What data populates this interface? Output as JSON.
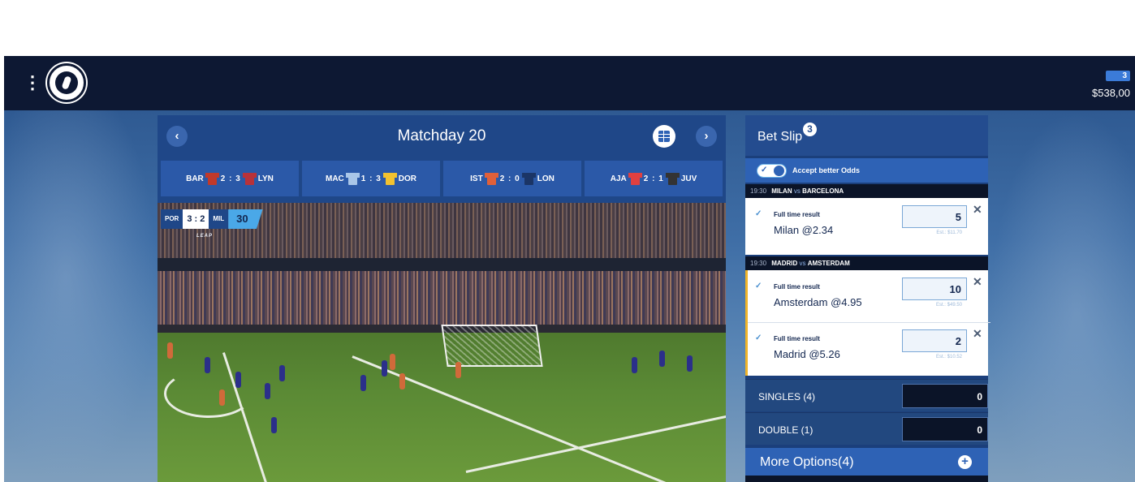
{
  "topbar": {
    "menu_icon": "more-vertical-icon",
    "logo_icon": "league-logo-icon",
    "wallet_badge": "3",
    "balance": "$538,00"
  },
  "matchday": {
    "title": "Matchday 20",
    "prev_icon": "chevron-left-icon",
    "next_icon": "chevron-right-icon",
    "table_icon": "table-icon",
    "results": [
      {
        "home": "BAR",
        "score": "2 : 3",
        "away": "LYN",
        "home_color": "#c0392b",
        "away_color": "#b8323a"
      },
      {
        "home": "MAC",
        "score": "1 : 3",
        "away": "DOR",
        "home_color": "#a9c6e8",
        "away_color": "#f2c230"
      },
      {
        "home": "IST",
        "score": "2 : 0",
        "away": "LON",
        "home_color": "#e0603a",
        "away_color": "#1b3566"
      },
      {
        "home": "AJA",
        "score": "2 : 1",
        "away": "JUV",
        "home_color": "#e04040",
        "away_color": "#333333"
      }
    ]
  },
  "live": {
    "home": "POR",
    "score": "3 : 2",
    "away": "MIL",
    "minute": "30",
    "tag": "LEAP"
  },
  "betslip": {
    "title": "Bet Slip",
    "count": "3",
    "accept_label": "Accept better Odds",
    "matches": [
      {
        "time": "19:30",
        "home": "MILAN",
        "vs": "vs",
        "away": "BARCELONA",
        "bets": [
          {
            "market": "Full time result",
            "selection": "Milan @2.34",
            "stake": "5",
            "est": "Est.: $11.70"
          }
        ]
      },
      {
        "time": "19:30",
        "home": "MADRID",
        "vs": "vs",
        "away": "AMSTERDAM",
        "bets": [
          {
            "market": "Full time result",
            "selection": "Amsterdam @4.95",
            "stake": "10",
            "est": "Est.: $49.50"
          },
          {
            "market": "Full time result",
            "selection": "Madrid @5.26",
            "stake": "2",
            "est": "Est.: $10.52"
          }
        ]
      }
    ],
    "singles_label": "SINGLES (4)",
    "singles_value": "0",
    "double_label": "DOUBLE (1)",
    "double_value": "0",
    "more_options": "More Options(4)"
  }
}
